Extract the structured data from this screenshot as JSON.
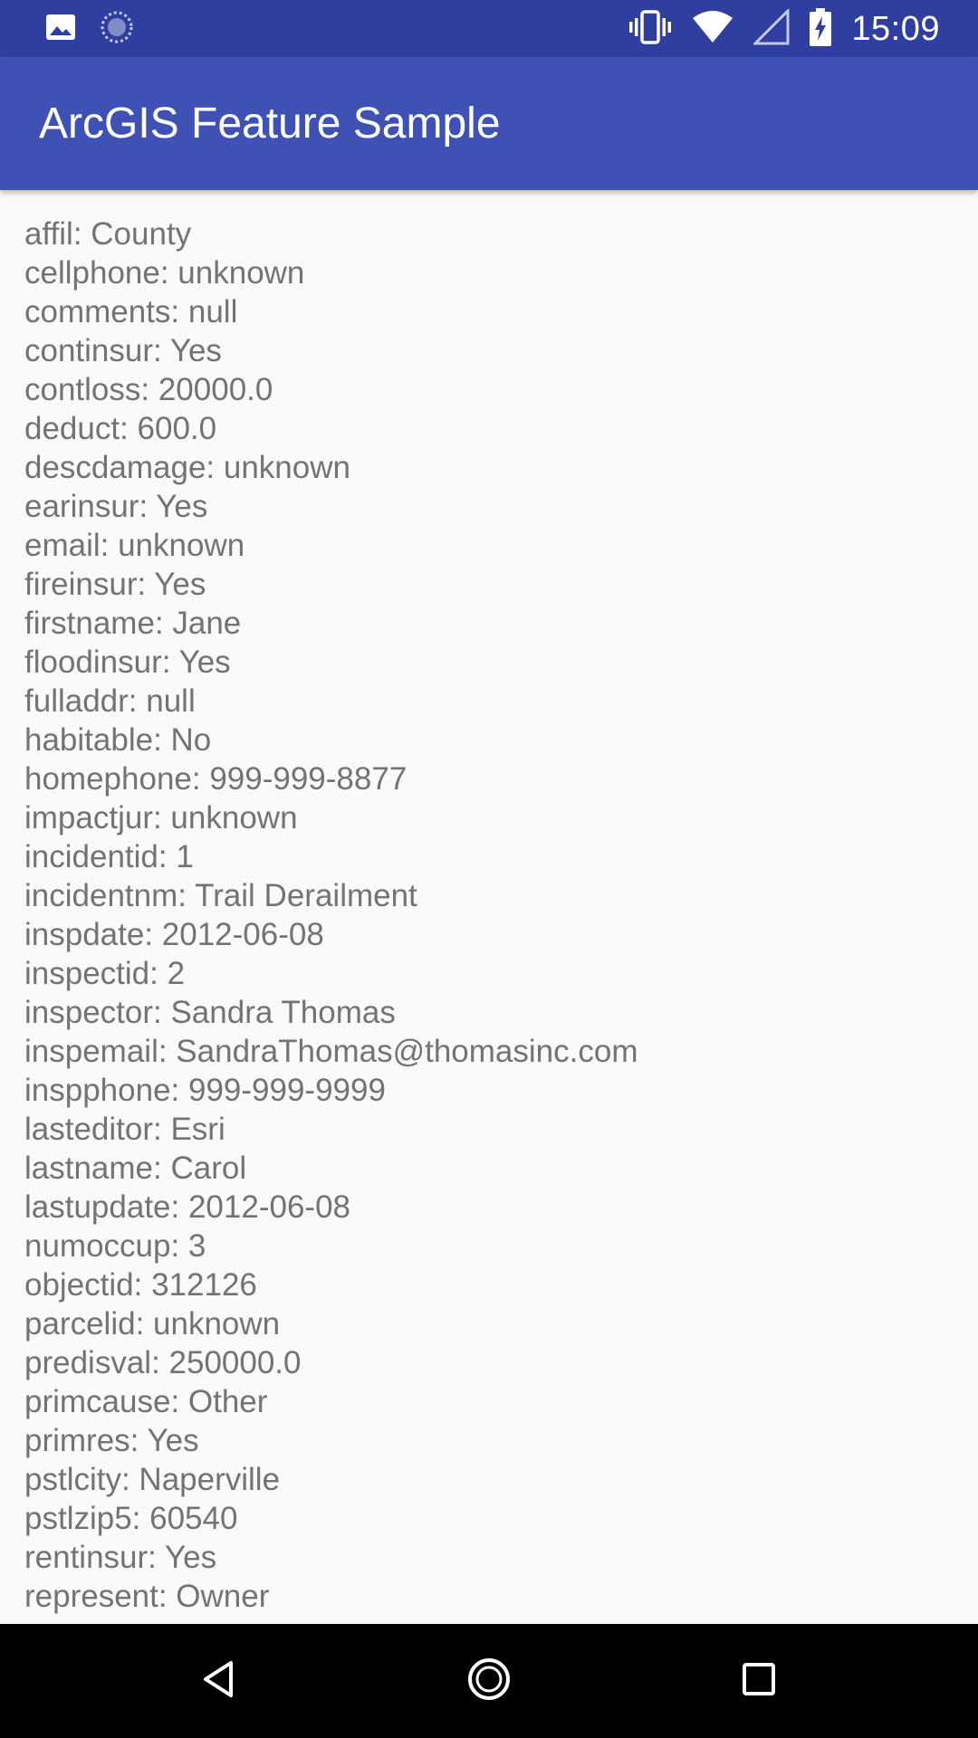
{
  "status_bar": {
    "time": "15:09",
    "icons": [
      "image-icon",
      "sync-icon",
      "vibrate-icon",
      "wifi-icon",
      "cellular-signal-icon",
      "battery-charging-icon"
    ]
  },
  "app_bar": {
    "title": "ArcGIS Feature Sample"
  },
  "attributes": [
    "affil: County",
    "cellphone: unknown",
    "comments: null",
    "continsur: Yes",
    "contloss: 20000.0",
    "deduct: 600.0",
    "descdamage: unknown",
    "earinsur: Yes",
    "email: unknown",
    "fireinsur: Yes",
    "firstname: Jane",
    "floodinsur: Yes",
    "fulladdr: null",
    "habitable: No",
    "homephone: 999-999-8877",
    "impactjur: unknown",
    "incidentid: 1",
    "incidentnm: Trail Derailment",
    "inspdate: 2012-06-08",
    "inspectid: 2",
    "inspector: Sandra Thomas",
    "inspemail: SandraThomas@thomasinc.com",
    "inspphone: 999-999-9999",
    "lasteditor: Esri",
    "lastname: Carol",
    "lastupdate: 2012-06-08",
    "numoccup: 3",
    "objectid: 312126",
    "parcelid: unknown",
    "predisval: 250000.0",
    "primcause: Other",
    "primres: Yes",
    "pstlcity: Naperville",
    "pstlzip5: 60540",
    "rentinsur: Yes",
    "represent: Owner"
  ],
  "nav_bar": {
    "buttons": [
      "back-icon",
      "home-icon",
      "recents-icon"
    ]
  },
  "colors": {
    "status_bar": "#303f9f",
    "app_bar": "#3f51b5",
    "text": "#737373",
    "background": "#fafafa",
    "nav_bar": "#000000"
  }
}
